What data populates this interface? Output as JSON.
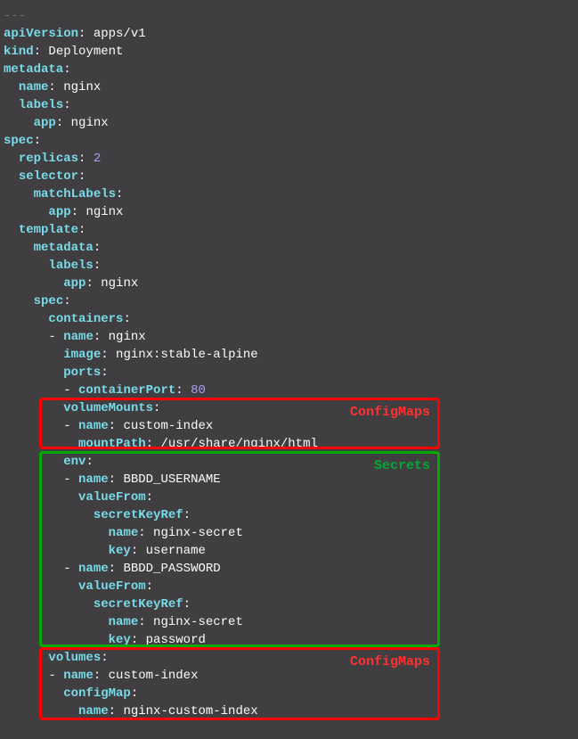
{
  "lines": {
    "l0": "---",
    "l1_k": "apiVersion",
    "l1_v": "apps/v1",
    "l2_k": "kind",
    "l2_v": "Deployment",
    "l3_k": "metadata",
    "l4_k": "name",
    "l4_v": "nginx",
    "l5_k": "labels",
    "l6_k": "app",
    "l6_v": "nginx",
    "l7_k": "spec",
    "l8_k": "replicas",
    "l8_v": "2",
    "l9_k": "selector",
    "l10_k": "matchLabels",
    "l11_k": "app",
    "l11_v": "nginx",
    "l12_k": "template",
    "l13_k": "metadata",
    "l14_k": "labels",
    "l15_k": "app",
    "l15_v": "nginx",
    "l16_k": "spec",
    "l17_k": "containers",
    "l18_k": "name",
    "l18_v": "nginx",
    "l19_k": "image",
    "l19_v": "nginx:stable-alpine",
    "l20_k": "ports",
    "l21_k": "containerPort",
    "l21_v": "80",
    "l22_k": "volumeMounts",
    "l23_k": "name",
    "l23_v": "custom-index",
    "l24_k": "mountPath",
    "l24_v": "/usr/share/nginx/html",
    "l25_k": "env",
    "l26_k": "name",
    "l26_v": "BBDD_USERNAME",
    "l27_k": "valueFrom",
    "l28_k": "secretKeyRef",
    "l29_k": "name",
    "l29_v": "nginx-secret",
    "l30_k": "key",
    "l30_v": "username",
    "l31_k": "name",
    "l31_v": "BBDD_PASSWORD",
    "l32_k": "valueFrom",
    "l33_k": "secretKeyRef",
    "l34_k": "name",
    "l34_v": "nginx-secret",
    "l35_k": "key",
    "l35_v": "password",
    "l36_k": "volumes",
    "l37_k": "name",
    "l37_v": "custom-index",
    "l38_k": "configMap",
    "l39_k": "name",
    "l39_v": "nginx-custom-index"
  },
  "labels": {
    "configmaps": "ConfigMaps",
    "secrets": "Secrets"
  }
}
